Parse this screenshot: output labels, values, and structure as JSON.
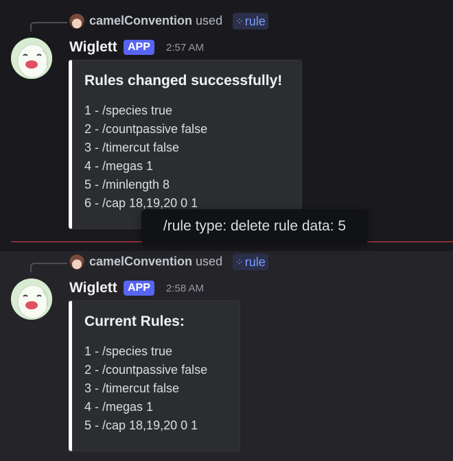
{
  "messages": [
    {
      "reply": {
        "username": "camelConvention",
        "used": "used",
        "command": "rule"
      },
      "author": "Wiglett",
      "badge": "APP",
      "time": "2:57 AM",
      "embed": {
        "title": "Rules changed successfully!",
        "lines": [
          "1 - /species true",
          "2 - /countpassive false",
          "3 - /timercut false",
          "4 - /megas 1",
          "5 - /minlength 8",
          "6 - /cap 18,19,20 0 1"
        ]
      }
    },
    {
      "reply": {
        "username": "camelConvention",
        "used": "used",
        "command": "rule"
      },
      "author": "Wiglett",
      "badge": "APP",
      "time": "2:58 AM",
      "embed": {
        "title": "Current Rules:",
        "lines": [
          "1 - /species true",
          "2 - /countpassive false",
          "3 - /timercut false",
          "4 - /megas 1",
          "5 - /cap 18,19,20 0 1"
        ]
      }
    }
  ],
  "tooltip": "/rule type: delete rule data: 5",
  "colors": {
    "accent": "#5865f2",
    "command": "#7b9cff",
    "divider": "#f23f43",
    "embed_border": "#ffffff"
  },
  "icons": {
    "command": "apps-icon"
  }
}
